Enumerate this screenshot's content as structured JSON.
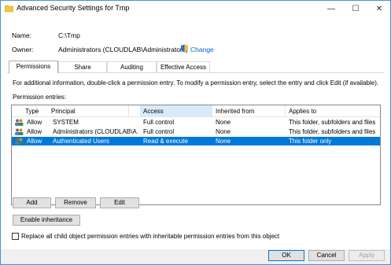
{
  "window": {
    "title": "Advanced Security Settings for Tmp",
    "minimize_glyph": "—",
    "maximize_glyph": "☐",
    "close_glyph": "✕"
  },
  "info": {
    "name_label": "Name:",
    "name_value": "C:\\Tmp",
    "owner_label": "Owner:",
    "owner_value": "Administrators (CLOUDLAB\\Administrators)",
    "change_link": "Change"
  },
  "tabs": [
    {
      "label": "Permissions",
      "active": true
    },
    {
      "label": "Share",
      "active": false
    },
    {
      "label": "Auditing",
      "active": false
    },
    {
      "label": "Effective Access",
      "active": false
    }
  ],
  "permissions": {
    "info_text": "For additional information, double-click a permission entry. To modify a permission entry, select the entry and click Edit (if available).",
    "entries_label": "Permission entries:",
    "columns": [
      "Type",
      "Principal",
      "Access",
      "Inherited from",
      "Applies to"
    ],
    "rows": [
      {
        "icon": "users-icon",
        "type": "Allow",
        "principal": "SYSTEM",
        "access": "Full control",
        "inherited": "None",
        "applies": "This folder, subfolders and files",
        "selected": false
      },
      {
        "icon": "users-icon",
        "type": "Allow",
        "principal": "Administrators (CLOUDLAB\\A...",
        "access": "Full control",
        "inherited": "None",
        "applies": "This folder, subfolders and files",
        "selected": false
      },
      {
        "icon": "users-icon",
        "type": "Allow",
        "principal": "Authenticated Users",
        "access": "Read & execute",
        "inherited": "None",
        "applies": "This folder only",
        "selected": true
      }
    ]
  },
  "buttons": {
    "add": "Add",
    "remove": "Remove",
    "edit": "Edit",
    "enable_inheritance": "Enable inheritance",
    "replace_checkbox_label": "Replace all child object permission entries with inheritable permission entries from this object",
    "ok": "OK",
    "cancel": "Cancel",
    "apply": "Apply"
  },
  "colors": {
    "selection": "#0078d7",
    "link": "#0066cc",
    "window_border": "#4a90d9"
  }
}
